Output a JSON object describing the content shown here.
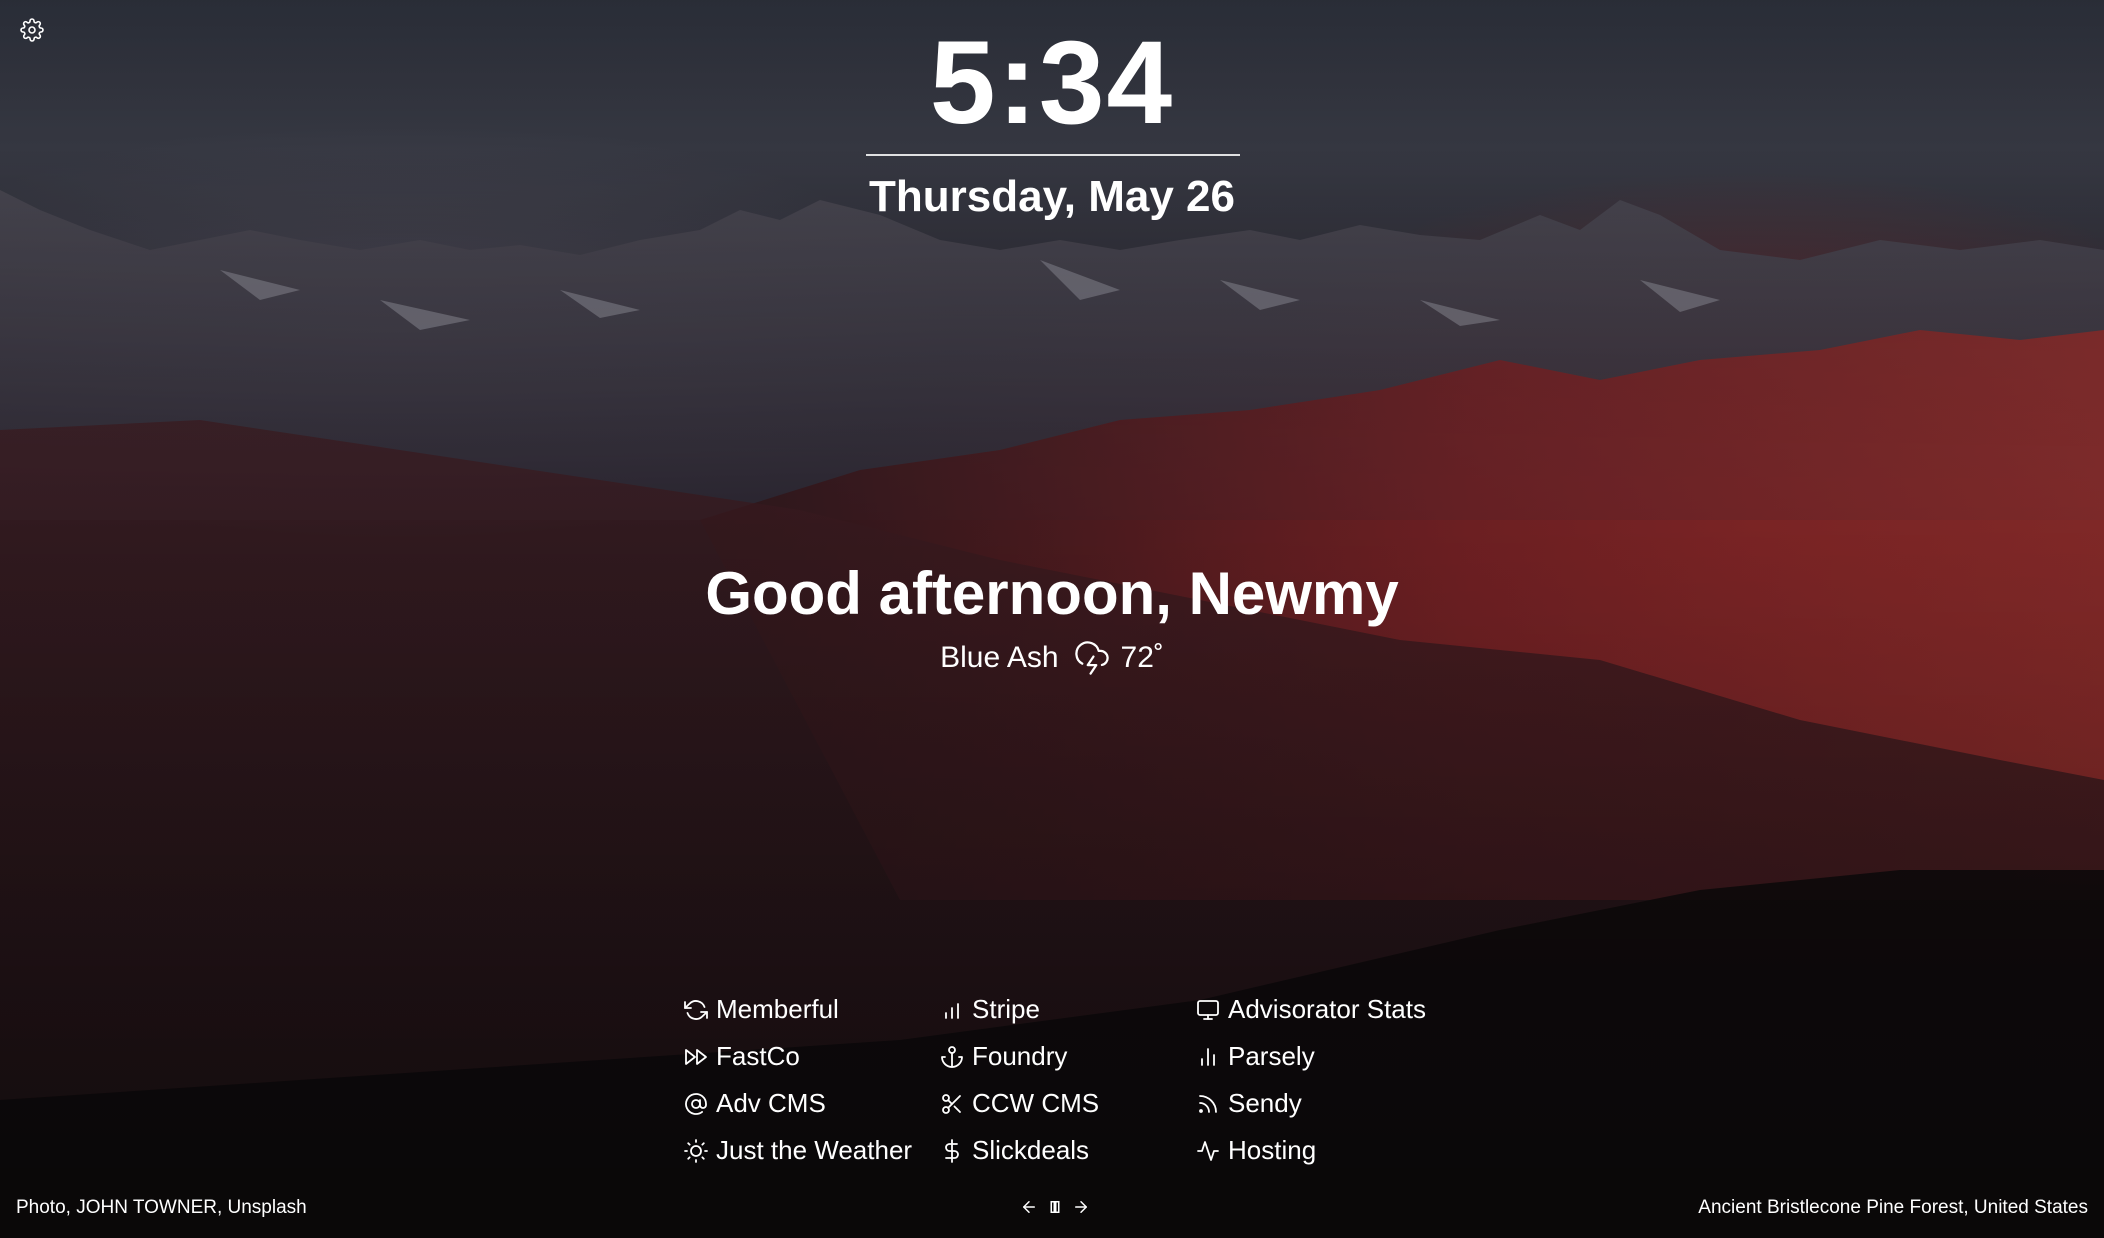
{
  "clock": {
    "time": "5:34"
  },
  "date": {
    "label": "Thursday, May 26"
  },
  "greeting": {
    "text": "Good afternoon, Newmy"
  },
  "weather": {
    "location": "Blue Ash",
    "icon": "cloud-lightning-icon",
    "temperature": "72˚"
  },
  "links": [
    {
      "label": "Memberful",
      "icon": "refresh-icon"
    },
    {
      "label": "Stripe",
      "icon": "bar-chart-icon"
    },
    {
      "label": "Advisorator Stats",
      "icon": "monitor-icon"
    },
    {
      "label": "FastCo",
      "icon": "fast-forward-icon"
    },
    {
      "label": "Foundry",
      "icon": "anchor-icon"
    },
    {
      "label": "Parsely",
      "icon": "bar-chart-2-icon"
    },
    {
      "label": "Adv CMS",
      "icon": "at-sign-icon"
    },
    {
      "label": "CCW CMS",
      "icon": "scissors-icon"
    },
    {
      "label": "Sendy",
      "icon": "rss-icon"
    },
    {
      "label": "Just the Weather",
      "icon": "sun-icon"
    },
    {
      "label": "Slickdeals",
      "icon": "dollar-sign-icon"
    },
    {
      "label": "Hosting",
      "icon": "activity-icon"
    }
  ],
  "footer": {
    "photo_credit": "Photo, JOHN TOWNER, Unsplash",
    "location": "Ancient Bristlecone Pine Forest, United States"
  },
  "colors": {
    "text": "#ffffff",
    "accent_red": "#8c2323",
    "sky": "#2f333e"
  }
}
